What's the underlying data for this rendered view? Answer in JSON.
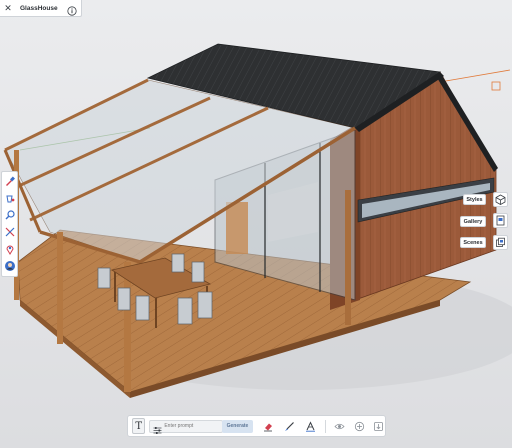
{
  "app": {
    "title": "GlassHouse"
  },
  "right_panel": {
    "styles_label": "Styles",
    "gallery_label": "Gallery",
    "scenes_label": "Scenes"
  },
  "bottom_toolbar": {
    "prompt_placeholder": "Enter prompt",
    "generate_label": "Generate"
  },
  "left_toolbar": {
    "tools": [
      "eyedropper-icon",
      "paint-bucket-icon",
      "search-zoom-icon",
      "split-tool-icon",
      "location-pin-icon",
      "avatar-icon"
    ]
  },
  "icons": [
    "close-icon",
    "info-icon",
    "isometric-box-icon",
    "sliders-icon",
    "eraser-icon",
    "brush-icon",
    "text-style-icon",
    "eye-icon",
    "add-icon",
    "download-icon"
  ],
  "colors": {
    "accent_red": "#d2404f",
    "accent_blue": "#3c6fc8",
    "generate_bg": "#d7e3f1",
    "roof": "#2d2f31",
    "cladding": "#9b5a3a",
    "deck": "#b77c48"
  }
}
